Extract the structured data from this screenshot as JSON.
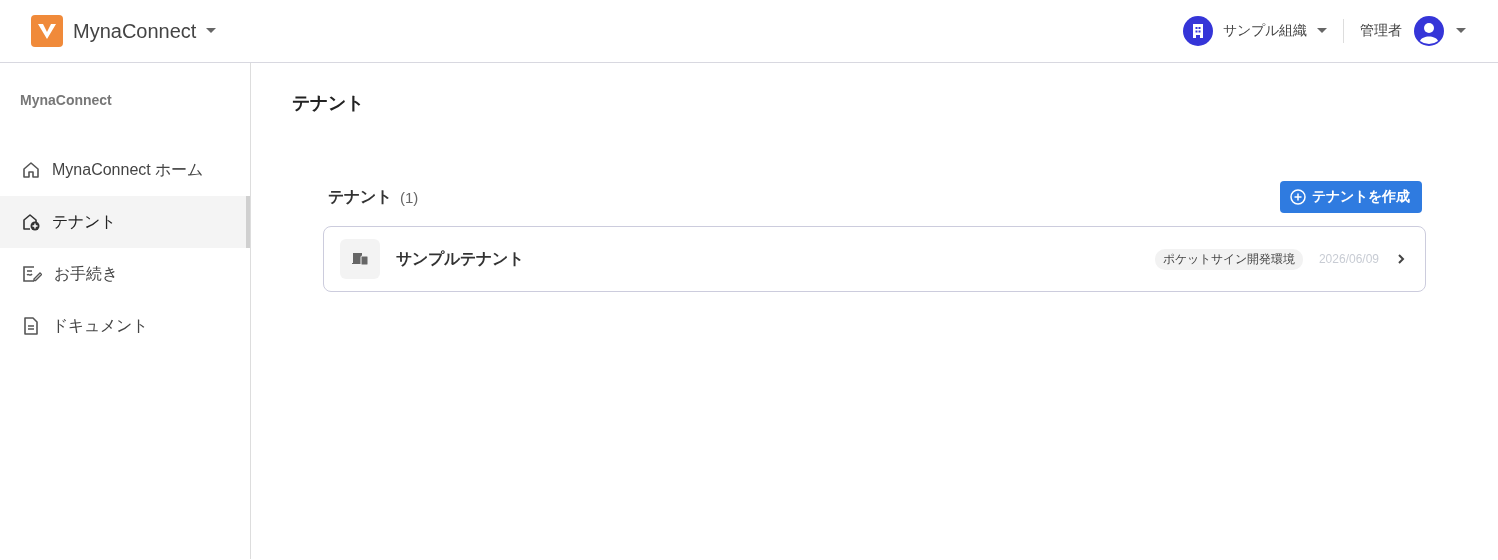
{
  "header": {
    "app_name": "MynaConnect",
    "organization": "サンプル組織",
    "role": "管理者"
  },
  "sidebar": {
    "title": "MynaConnect",
    "items": [
      {
        "kind": "home",
        "label": "MynaConnect ホーム",
        "selected": false
      },
      {
        "kind": "tenant",
        "label": "テナント",
        "selected": true
      },
      {
        "kind": "procedure",
        "label": "お手続き",
        "selected": false
      },
      {
        "kind": "document",
        "label": "ドキュメント",
        "selected": false
      }
    ]
  },
  "page": {
    "title": "テナント",
    "section_title": "テナント",
    "count": "(1)",
    "create_button": "テナントを作成",
    "tenants": [
      {
        "name": "サンプルテナント",
        "tag": "ポケットサイン開発環境",
        "date": "2026/06/09"
      }
    ]
  }
}
